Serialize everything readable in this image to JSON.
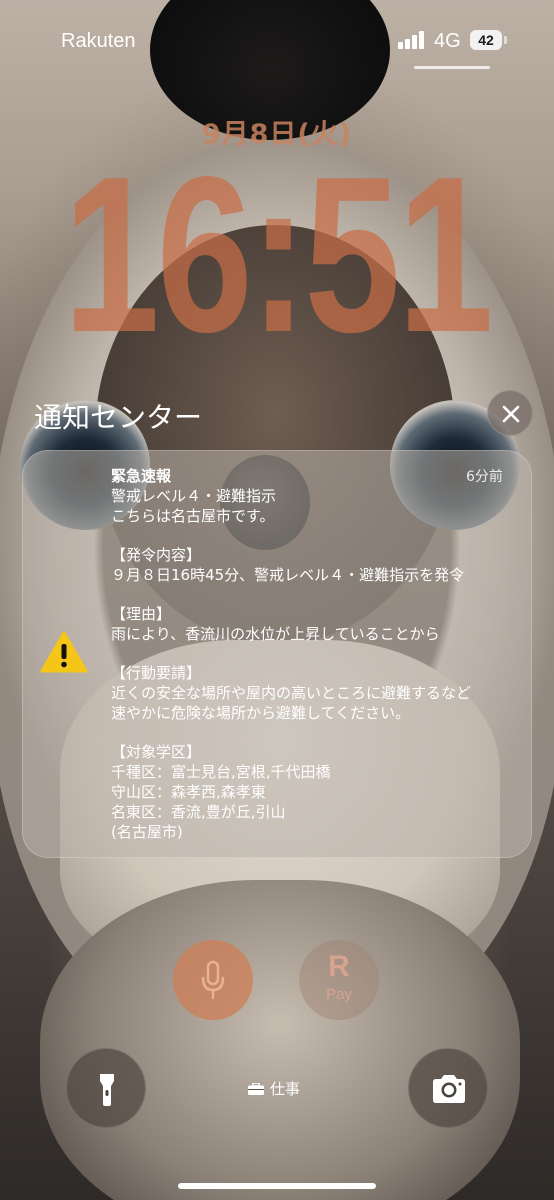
{
  "status_bar": {
    "carrier": "Rakuten",
    "network": "4G",
    "battery": "42"
  },
  "lock": {
    "date": "9月8日(火)",
    "time": "16:51"
  },
  "notification_center": {
    "title": "通知センター",
    "notification": {
      "title": "緊急速報",
      "time": "6分前",
      "lines": [
        "警戒レベル４・避難指示",
        "こちらは名古屋市です。",
        "",
        "【発令内容】",
        "９月８日16時45分、警戒レベル４・避難指示を発令",
        "",
        "【理由】",
        "雨により、香流川の水位が上昇していることから",
        "",
        "【行動要請】",
        "近くの安全な場所や屋内の高いところに避難するなど",
        "速やかに危険な場所から避難してください。",
        "",
        "【対象学区】",
        "千種区：富士見台,宮根,千代田橋",
        "守山区：森孝西,森孝東",
        "名東区：香流,豊が丘,引山",
        "(名古屋市)"
      ],
      "icon": "warning-icon"
    }
  },
  "bottom": {
    "focus_label": "仕事",
    "rakuten_pay_letter": "R",
    "rakuten_pay_label": "Pay",
    "icons": [
      "flashlight-icon",
      "camera-icon",
      "microphone-icon",
      "briefcase-icon"
    ]
  },
  "colors": {
    "clock": "#c86e46",
    "warning_yellow": "#f5c518",
    "card_bg": "#b9b2aa"
  }
}
